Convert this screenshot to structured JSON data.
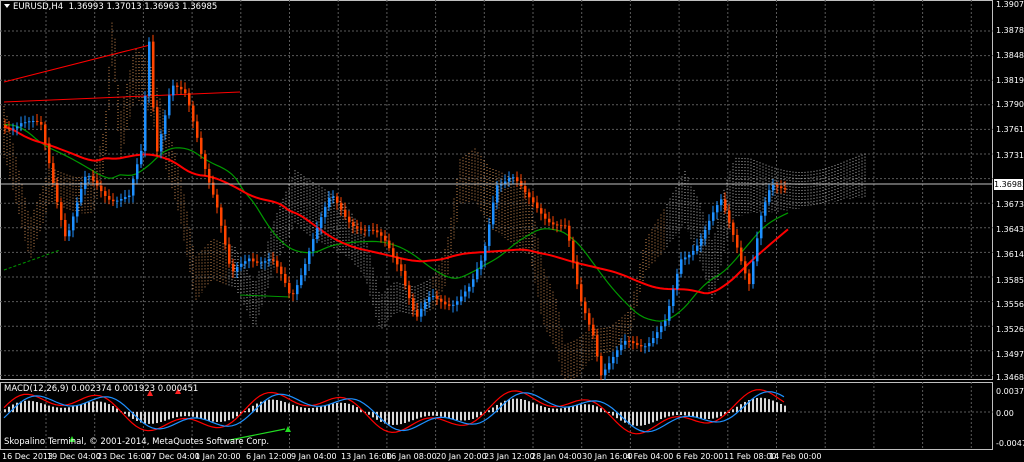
{
  "header": {
    "symbol_timeframe": "EURUSD,H4",
    "open": "1.36993",
    "high": "1.37013",
    "low": "1.36963",
    "close": "1.36985"
  },
  "current_price": "1.36985",
  "price_axis": [
    "1.39070",
    "1.38780",
    "1.38485",
    "1.38195",
    "1.37900",
    "1.37610",
    "1.37315",
    "1.36730",
    "1.36435",
    "1.36145",
    "1.35850",
    "1.35560",
    "1.35265",
    "1.34975",
    "1.34680"
  ],
  "macd": {
    "label": "MACD(12,26,9) 0.002374 0.001923 0.000451",
    "axis": [
      "0.003799",
      "0.00",
      "-0.004727"
    ]
  },
  "time_axis": [
    "16 Dec 2013",
    "19 Dec 04:00",
    "23 Dec 16:00",
    "27 Dec 04:00",
    "1 Jan 20:00",
    "6 Jan 12:00",
    "9 Jan 04:00",
    "13 Jan 16:00",
    "16 Jan 08:00",
    "20 Jan 20:00",
    "23 Jan 12:00",
    "28 Jan 04:00",
    "30 Jan 16:00",
    "4 Feb 04:00",
    "6 Feb 20:00",
    "11 Feb 08:00",
    "14 Feb 00:00"
  ],
  "copyright": "Skopalino Terminal, © 2001-2014, MetaQuotes Software Corp.",
  "colors": {
    "background": "#000000",
    "grid": "#5a5a5a",
    "bull_candle": "#1e90ff",
    "bear_candle": "#ff4500",
    "slow_ma": "#ff0000",
    "fast_ma": "#009900",
    "cloud_bull": "#f4a460",
    "cloud_bear": "#d8d8d8",
    "macd_main": "#ff0000",
    "macd_signal": "#1e90ff",
    "histogram": "#d8d8d8"
  }
}
